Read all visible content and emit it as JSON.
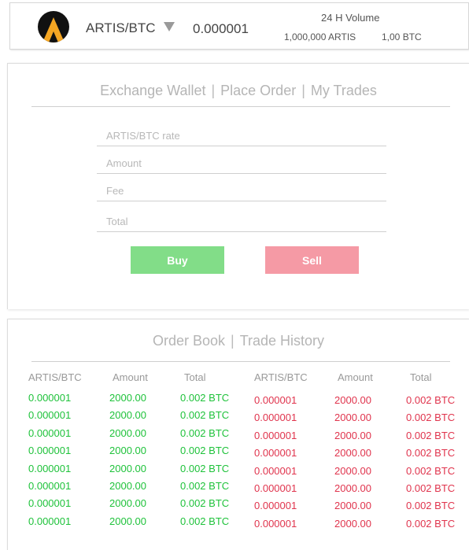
{
  "header": {
    "pair": "ARTIS/BTC",
    "price": "0.000001",
    "volume_title": "24 H Volume",
    "volume_artis": "1,000,000 ARTIS",
    "volume_btc": "1,00 BTC",
    "logo_icon": "artis-logo-icon",
    "caret_icon": "caret-down-icon"
  },
  "order_panel": {
    "tabs": [
      "Exchange Wallet",
      "Place Order",
      "My Trades"
    ],
    "separator": "|",
    "fields": {
      "rate_placeholder": "ARTIS/BTC rate",
      "amount_placeholder": "Amount",
      "fee_placeholder": "Fee",
      "total_placeholder": "Total"
    },
    "buy_label": "Buy",
    "sell_label": "Sell",
    "colors": {
      "buy": "#82dd88",
      "sell": "#f59aa5"
    }
  },
  "order_book": {
    "tabs": [
      "Order Book",
      "Trade History"
    ],
    "separator": "|",
    "buy_headers": [
      "ARTIS/BTC",
      "Amount",
      "Total"
    ],
    "sell_headers": [
      "ARTIS/BTC",
      "Amount",
      "Total"
    ],
    "colors": {
      "buy": "#1ec23a",
      "sell": "#e0344d"
    },
    "buy_rows": [
      [
        "0.000001",
        "2000.00",
        "0.002 BTC"
      ],
      [
        "0.000001",
        "2000.00",
        "0.002 BTC"
      ],
      [
        "0.000001",
        "2000.00",
        "0.002 BTC"
      ],
      [
        "0.000001",
        "2000.00",
        "0.002 BTC"
      ],
      [
        "0.000001",
        "2000.00",
        "0.002 BTC"
      ],
      [
        "0.000001",
        "2000.00",
        "0.002 BTC"
      ],
      [
        "0.000001",
        "2000.00",
        "0.002 BTC"
      ],
      [
        "0.000001",
        "2000.00",
        "0.002 BTC"
      ]
    ],
    "sell_rows": [
      [
        "0.000001",
        "2000.00",
        "0.002 BTC"
      ],
      [
        "0.000001",
        "2000.00",
        "0.002 BTC"
      ],
      [
        "0.000001",
        "2000.00",
        "0.002 BTC"
      ],
      [
        "0.000001",
        "2000.00",
        "0.002 BTC"
      ],
      [
        "0.000001",
        "2000.00",
        "0.002 BTC"
      ],
      [
        "0.000001",
        "2000.00",
        "0.002 BTC"
      ],
      [
        "0.000001",
        "2000.00",
        "0.002 BTC"
      ],
      [
        "0.000001",
        "2000.00",
        "0.002 BTC"
      ]
    ]
  }
}
